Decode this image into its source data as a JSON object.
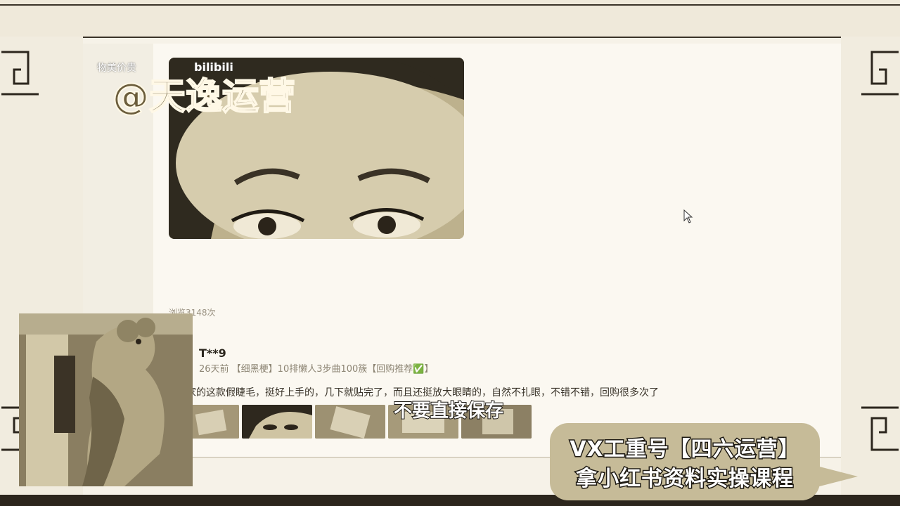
{
  "watermark": {
    "top_text": "物美价贵",
    "brand": "@天逸运营",
    "bili": "bilibili"
  },
  "review": {
    "view_count": "浏览3148次",
    "user": "T**9",
    "meta": "26天前 【细黑梗】10排懒人3步曲100簇【回购推荐✅】",
    "text": "家的这款假睫毛，挺好上手的，几下就贴完了，而且还挺放大眼睛的，自然不扎眼，不错不错，回购很多次了",
    "thumbnail_count": 5
  },
  "subtitle": "不要直接保存",
  "promo": {
    "line1": "VX工重号【四六运营】",
    "line2": "拿小红书资料实操课程"
  },
  "colors": {
    "frame_dark": "#2c261d",
    "page_bg": "#fbf8f1",
    "promo_bg": "#c6bb98",
    "meta_text": "#8c8473"
  },
  "icons": {
    "cursor": "mouse-pointer-icon",
    "corner": "corner-ornament-icon"
  }
}
